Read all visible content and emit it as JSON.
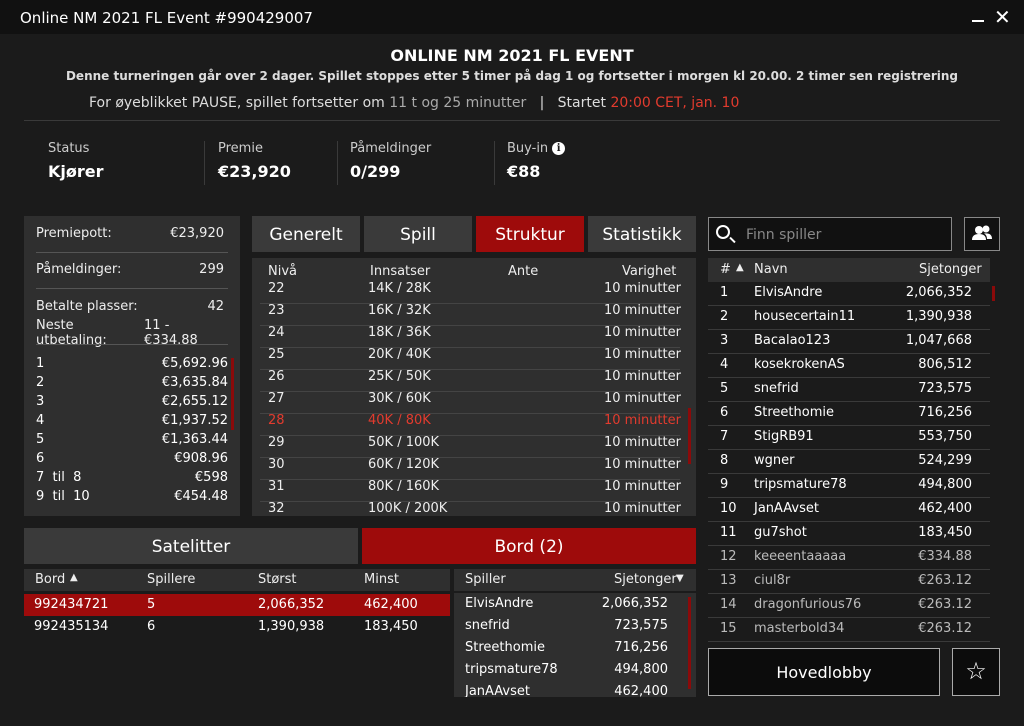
{
  "window": {
    "title": "Online NM 2021 FL Event #990429007"
  },
  "header": {
    "title": "ONLINE NM 2021 FL EVENT",
    "subtitle": "Denne turneringen går over 2 dager. Spillet stoppes etter 5 timer på dag 1 og fortsetter i morgen kl 20.00. 2 timer sen registrering",
    "pause_text": "For øyeblikket PAUSE, spillet fortsetter om",
    "pause_time": "11 t og 25 minutter",
    "divider": "|",
    "started_label": "Startet",
    "started_value": "20:00 CET, jan. 10"
  },
  "stats": [
    {
      "label": "Status",
      "value": "Kjører"
    },
    {
      "label": "Premie",
      "value": "€23,920"
    },
    {
      "label": "Påmeldinger",
      "value": "0/299"
    },
    {
      "label": "Buy-in",
      "value": "€88"
    }
  ],
  "summary": {
    "prizepool_label": "Premiepott:",
    "prizepool_value": "€23,920",
    "entries_label": "Påmeldinger:",
    "entries_value": "299",
    "paid_label": "Betalte plasser:",
    "paid_value": "42",
    "next_label": "Neste utbetaling:",
    "next_value": "11 - €334.88",
    "prizes": [
      {
        "place": "1",
        "amount": "€5,692.96"
      },
      {
        "place": "2",
        "amount": "€3,635.84"
      },
      {
        "place": "3",
        "amount": "€2,655.12"
      },
      {
        "place": "4",
        "amount": "€1,937.52"
      },
      {
        "place": "5",
        "amount": "€1,363.44"
      },
      {
        "place": "6",
        "amount": "€908.96"
      },
      {
        "place": "7  til  8",
        "amount": "€598"
      },
      {
        "place": "9  til  10",
        "amount": "€454.48"
      }
    ]
  },
  "tabs": [
    "Generelt",
    "Spill",
    "Struktur",
    "Statistikk"
  ],
  "structure": {
    "headers": [
      "Nivå",
      "Innsatser",
      "Ante",
      "Varighet"
    ],
    "rows": [
      {
        "level": "22",
        "stakes": "14K / 28K",
        "ante": "",
        "duration": "10 minutter"
      },
      {
        "level": "23",
        "stakes": "16K / 32K",
        "ante": "",
        "duration": "10 minutter"
      },
      {
        "level": "24",
        "stakes": "18K / 36K",
        "ante": "",
        "duration": "10 minutter"
      },
      {
        "level": "25",
        "stakes": "20K / 40K",
        "ante": "",
        "duration": "10 minutter"
      },
      {
        "level": "26",
        "stakes": "25K / 50K",
        "ante": "",
        "duration": "10 minutter"
      },
      {
        "level": "27",
        "stakes": "30K / 60K",
        "ante": "",
        "duration": "10 minutter"
      },
      {
        "level": "28",
        "stakes": "40K / 80K",
        "ante": "",
        "duration": "10 minutter"
      },
      {
        "level": "29",
        "stakes": "50K / 100K",
        "ante": "",
        "duration": "10 minutter"
      },
      {
        "level": "30",
        "stakes": "60K / 120K",
        "ante": "",
        "duration": "10 minutter"
      },
      {
        "level": "31",
        "stakes": "80K / 160K",
        "ante": "",
        "duration": "10 minutter"
      },
      {
        "level": "32",
        "stakes": "100K / 200K",
        "ante": "",
        "duration": "10 minutter"
      }
    ],
    "highlight_level": "28"
  },
  "search": {
    "placeholder": "Finn spiller"
  },
  "leaderboard": {
    "headers": {
      "rank": "#",
      "name": "Navn",
      "chips": "Sjetonger"
    },
    "sort_arrow": "▲",
    "rows": [
      {
        "rank": "1",
        "name": "ElvisAndre",
        "chips": "2,066,352"
      },
      {
        "rank": "2",
        "name": "housecertain11",
        "chips": "1,390,938"
      },
      {
        "rank": "3",
        "name": "Bacalao123",
        "chips": "1,047,668"
      },
      {
        "rank": "4",
        "name": "kosekrokenAS",
        "chips": "806,512"
      },
      {
        "rank": "5",
        "name": "snefrid",
        "chips": "723,575"
      },
      {
        "rank": "6",
        "name": "Streethomie",
        "chips": "716,256"
      },
      {
        "rank": "7",
        "name": "StigRB91",
        "chips": "553,750"
      },
      {
        "rank": "8",
        "name": "wgner",
        "chips": "524,299"
      },
      {
        "rank": "9",
        "name": "tripsmature78",
        "chips": "494,800"
      },
      {
        "rank": "10",
        "name": "JanAAvset",
        "chips": "462,400"
      },
      {
        "rank": "11",
        "name": "gu7shot",
        "chips": "183,450"
      },
      {
        "rank": "12",
        "name": "keeeentaaaaa",
        "chips": "€334.88"
      },
      {
        "rank": "13",
        "name": "ciul8r",
        "chips": "€263.12"
      },
      {
        "rank": "14",
        "name": "dragonfurious76",
        "chips": "€263.12"
      },
      {
        "rank": "15",
        "name": "masterbold34",
        "chips": "€263.12"
      }
    ]
  },
  "bottom_tabs": {
    "satellites": "Satelitter",
    "tables": "Bord (2)"
  },
  "tables": {
    "headers": {
      "table": "Bord",
      "players": "Spillere",
      "largest": "Størst",
      "smallest": "Minst"
    },
    "sort_arrow": "▲",
    "rows": [
      {
        "table": "992434721",
        "players": "5",
        "largest": "2,066,352",
        "smallest": "462,400"
      },
      {
        "table": "992435134",
        "players": "6",
        "largest": "1,390,938",
        "smallest": "183,450"
      }
    ]
  },
  "table_players": {
    "headers": {
      "player": "Spiller",
      "chips": "Sjetonger"
    },
    "sort_arrow": "▼",
    "rows": [
      {
        "player": "ElvisAndre",
        "chips": "2,066,352"
      },
      {
        "player": "snefrid",
        "chips": "723,575"
      },
      {
        "player": "Streethomie",
        "chips": "716,256"
      },
      {
        "player": "tripsmature78",
        "chips": "494,800"
      },
      {
        "player": "JanAAvset",
        "chips": "462,400"
      }
    ]
  },
  "buttons": {
    "main_lobby": "Hovedlobby"
  },
  "colors": {
    "accent": "#9e0b0b",
    "highlight_text": "#e23b2e",
    "background": "#1b1b1b",
    "panel": "#2f2f2f"
  }
}
